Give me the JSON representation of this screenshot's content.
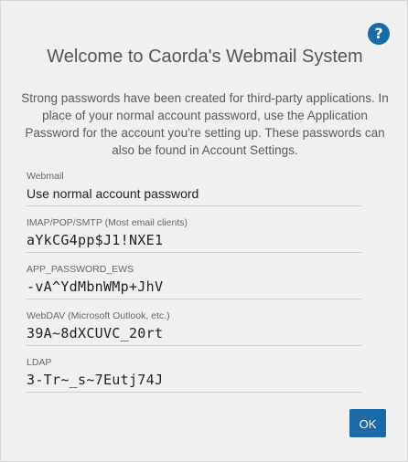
{
  "dialog": {
    "help_icon_glyph": "?",
    "title": "Welcome to Caorda's Webmail System",
    "description": "Strong passwords have been created for third-party applications. In place of your normal account password, use the Application Password for the account you're setting up. These passwords can also be found in Account Settings.",
    "fields": [
      {
        "label": "Webmail",
        "value": "Use normal account password"
      },
      {
        "label": "IMAP/POP/SMTP (Most email clients)",
        "value": "aYkCG4pp$J1!NXE1"
      },
      {
        "label": "APP_PASSWORD_EWS",
        "value": "-vA^YdMbnWMp+JhV"
      },
      {
        "label": "WebDAV (Microsoft Outlook, etc.)",
        "value": "39A~8dXCUVC_20rt"
      },
      {
        "label": "LDAP",
        "value": "3-Tr~_s~7Eutj74J"
      }
    ],
    "ok_label": "OK",
    "accent_color": "#1a6aa8"
  }
}
